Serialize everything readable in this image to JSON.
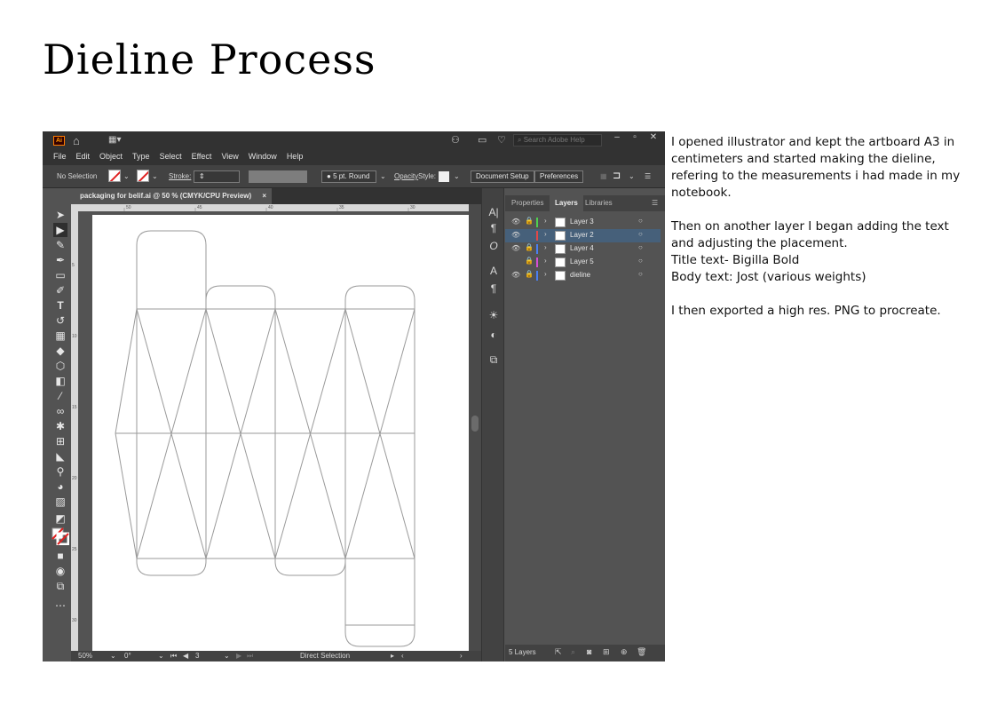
{
  "page": {
    "title": "Dieline Process"
  },
  "app": {
    "logo_text": "Ai",
    "search_placeholder": "Search Adobe Help",
    "menu": [
      "File",
      "Edit",
      "Object",
      "Type",
      "Select",
      "Effect",
      "View",
      "Window",
      "Help"
    ],
    "control_bar": {
      "selection": "No Selection",
      "stroke_label": "Stroke:",
      "brush": "5 pt. Round",
      "opacity_label": "Opacity",
      "style_label": "Style:",
      "document_setup": "Document Setup",
      "preferences": "Preferences"
    },
    "document_tab": {
      "label": "packaging for belif.ai @ 50 % (CMYK/CPU Preview)",
      "close": "×"
    },
    "status_bar": {
      "zoom": "50%",
      "rotation": "0°",
      "artboard": "3",
      "tool": "Direct Selection"
    },
    "panel": {
      "tabs": [
        "Properties",
        "Layers",
        "Libraries"
      ],
      "active_tab": "Layers",
      "layers": [
        {
          "name": "Layer 3",
          "color": "#4fd04f",
          "selected": false,
          "visible": true
        },
        {
          "name": "Layer 2",
          "color": "#e04848",
          "selected": true,
          "visible": true
        },
        {
          "name": "Layer 4",
          "color": "#4a7ff0",
          "selected": false,
          "visible": true
        },
        {
          "name": "Layer 5",
          "color": "#d44fd4",
          "selected": false,
          "visible": false
        },
        {
          "name": "dieline",
          "color": "#4a7ff0",
          "selected": false,
          "visible": true
        }
      ],
      "layer_count": "5 Layers"
    },
    "rulers": {
      "top_ticks": [
        "50",
        "45",
        "40",
        "35",
        "30"
      ],
      "left_ticks": [
        "5",
        "10",
        "15",
        "20",
        "25",
        "30"
      ]
    }
  },
  "description": {
    "paragraphs": [
      "I opened illustrator and kept the artboard A3 in centimeters and started making the dieline, refering to the measurements i had made in my notebook.",
      "Then on another layer I began adding the text and adjusting the placement.",
      "Title text- Bigilla Bold",
      "Body text: Jost (various weights)",
      "I then exported a high res. PNG to procreate."
    ]
  }
}
